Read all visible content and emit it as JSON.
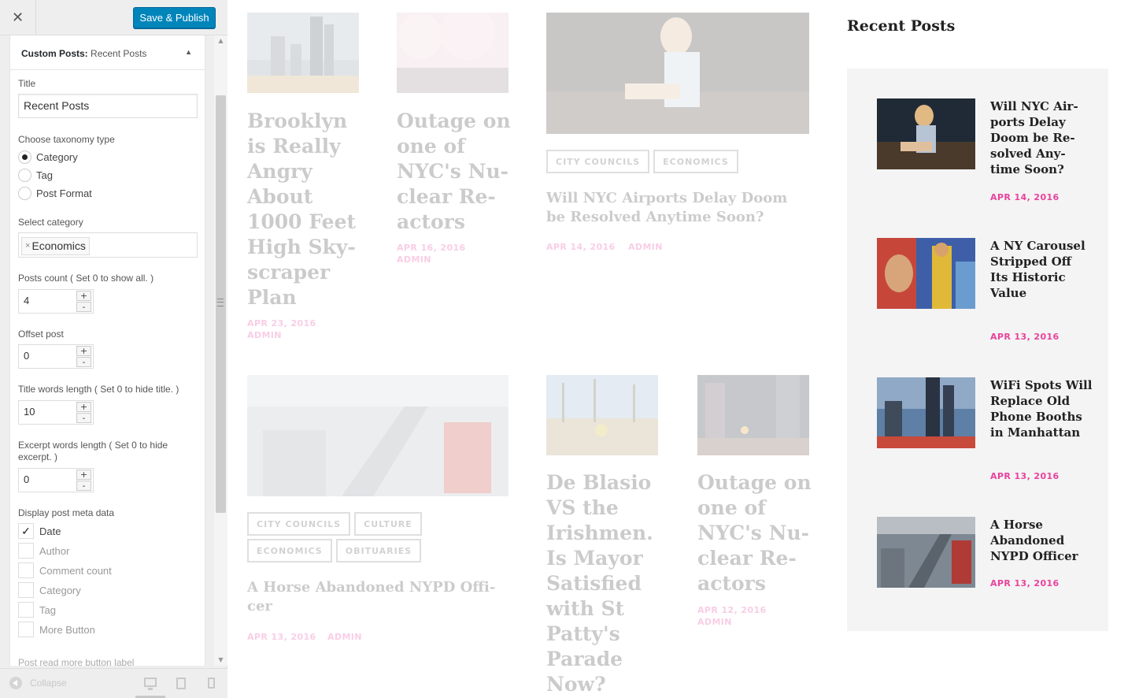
{
  "header": {
    "close_symbol": "✕",
    "publish_label": "Save & Publish"
  },
  "widget": {
    "title_bold": "Custom Posts:",
    "title_sub": "Recent Posts",
    "fields": {
      "title_label": "Title",
      "title_value": "Recent Posts",
      "taxonomy_label": "Choose taxonomy type",
      "taxonomy_options": [
        "Category",
        "Tag",
        "Post Format"
      ],
      "taxonomy_selected": "Category",
      "category_label": "Select category",
      "category_remove": "×",
      "category_selected": "Economics",
      "posts_count_label": "Posts count ( Set 0 to show all. )",
      "posts_count": "4",
      "offset_label": "Offset post",
      "offset": "0",
      "title_words_label": "Title words length ( Set 0 to hide title. )",
      "title_words": "10",
      "excerpt_label": "Excerpt words length ( Set 0 to hide excerpt. )",
      "excerpt_words": "0",
      "meta_label": "Display post meta data",
      "meta_options": [
        {
          "label": "Date",
          "checked": true
        },
        {
          "label": "Author",
          "checked": false
        },
        {
          "label": "Comment count",
          "checked": false
        },
        {
          "label": "Category",
          "checked": false
        },
        {
          "label": "Tag",
          "checked": false
        },
        {
          "label": "More Button",
          "checked": false
        }
      ],
      "read_more_label": "Post read more button label",
      "stepper_plus": "+",
      "stepper_minus": "-"
    }
  },
  "footer": {
    "collapse_label": "Collapse"
  },
  "preview": {
    "posts": [
      {
        "title": "Brooklyn is Really Angry About 1000 Feet High Sky-scraper Plan",
        "date": "APR 23, 2016",
        "author": "ADMIN"
      },
      {
        "title": "Outage on one of NYC's Nu-clear Re-actors",
        "date": "APR 16, 2016",
        "author": "ADMIN"
      },
      {
        "title": "Will NYC Airports Delay Doom be Resolved Anytime Soon?",
        "date": "APR 14, 2016",
        "author": "ADMIN",
        "tags": [
          "CITY COUNCILS",
          "ECONOMICS"
        ]
      },
      {
        "title": "A Horse Abandoned NYPD Offi-cer",
        "date": "APR 13, 2016",
        "author": "ADMIN",
        "tags": [
          "CITY COUNCILS",
          "CULTURE",
          "ECONOMICS",
          "OBITUARIES"
        ]
      },
      {
        "title": "De Blasio VS the Irishmen. Is Mayor Satisfied with St Patty's Parade Now?",
        "date": "",
        "author": ""
      },
      {
        "title": "Outage on one of NYC's Nu-clear Re-actors",
        "date": "APR 12, 2016",
        "author": "ADMIN"
      }
    ],
    "recent": {
      "heading": "Recent Posts",
      "items": [
        {
          "title": "Will NYC Air-ports Delay Doom be Re-solved Any-time Soon?",
          "date": "APR 14, 2016"
        },
        {
          "title": "A NY Carousel Stripped Off Its Historic Value",
          "date": "APR 13, 2016"
        },
        {
          "title": "WiFi Spots Will Replace Old Phone Booths in Manhattan",
          "date": "APR 13, 2016"
        },
        {
          "title": "A Horse Abandoned NYPD Officer",
          "date": "APR 13, 2016"
        }
      ]
    }
  },
  "colors": {
    "accent_pink": "#e8429c",
    "publish_blue": "#0085ba",
    "sidebar_bg": "#eeeeee",
    "recent_box_bg": "#f4f4f4"
  }
}
